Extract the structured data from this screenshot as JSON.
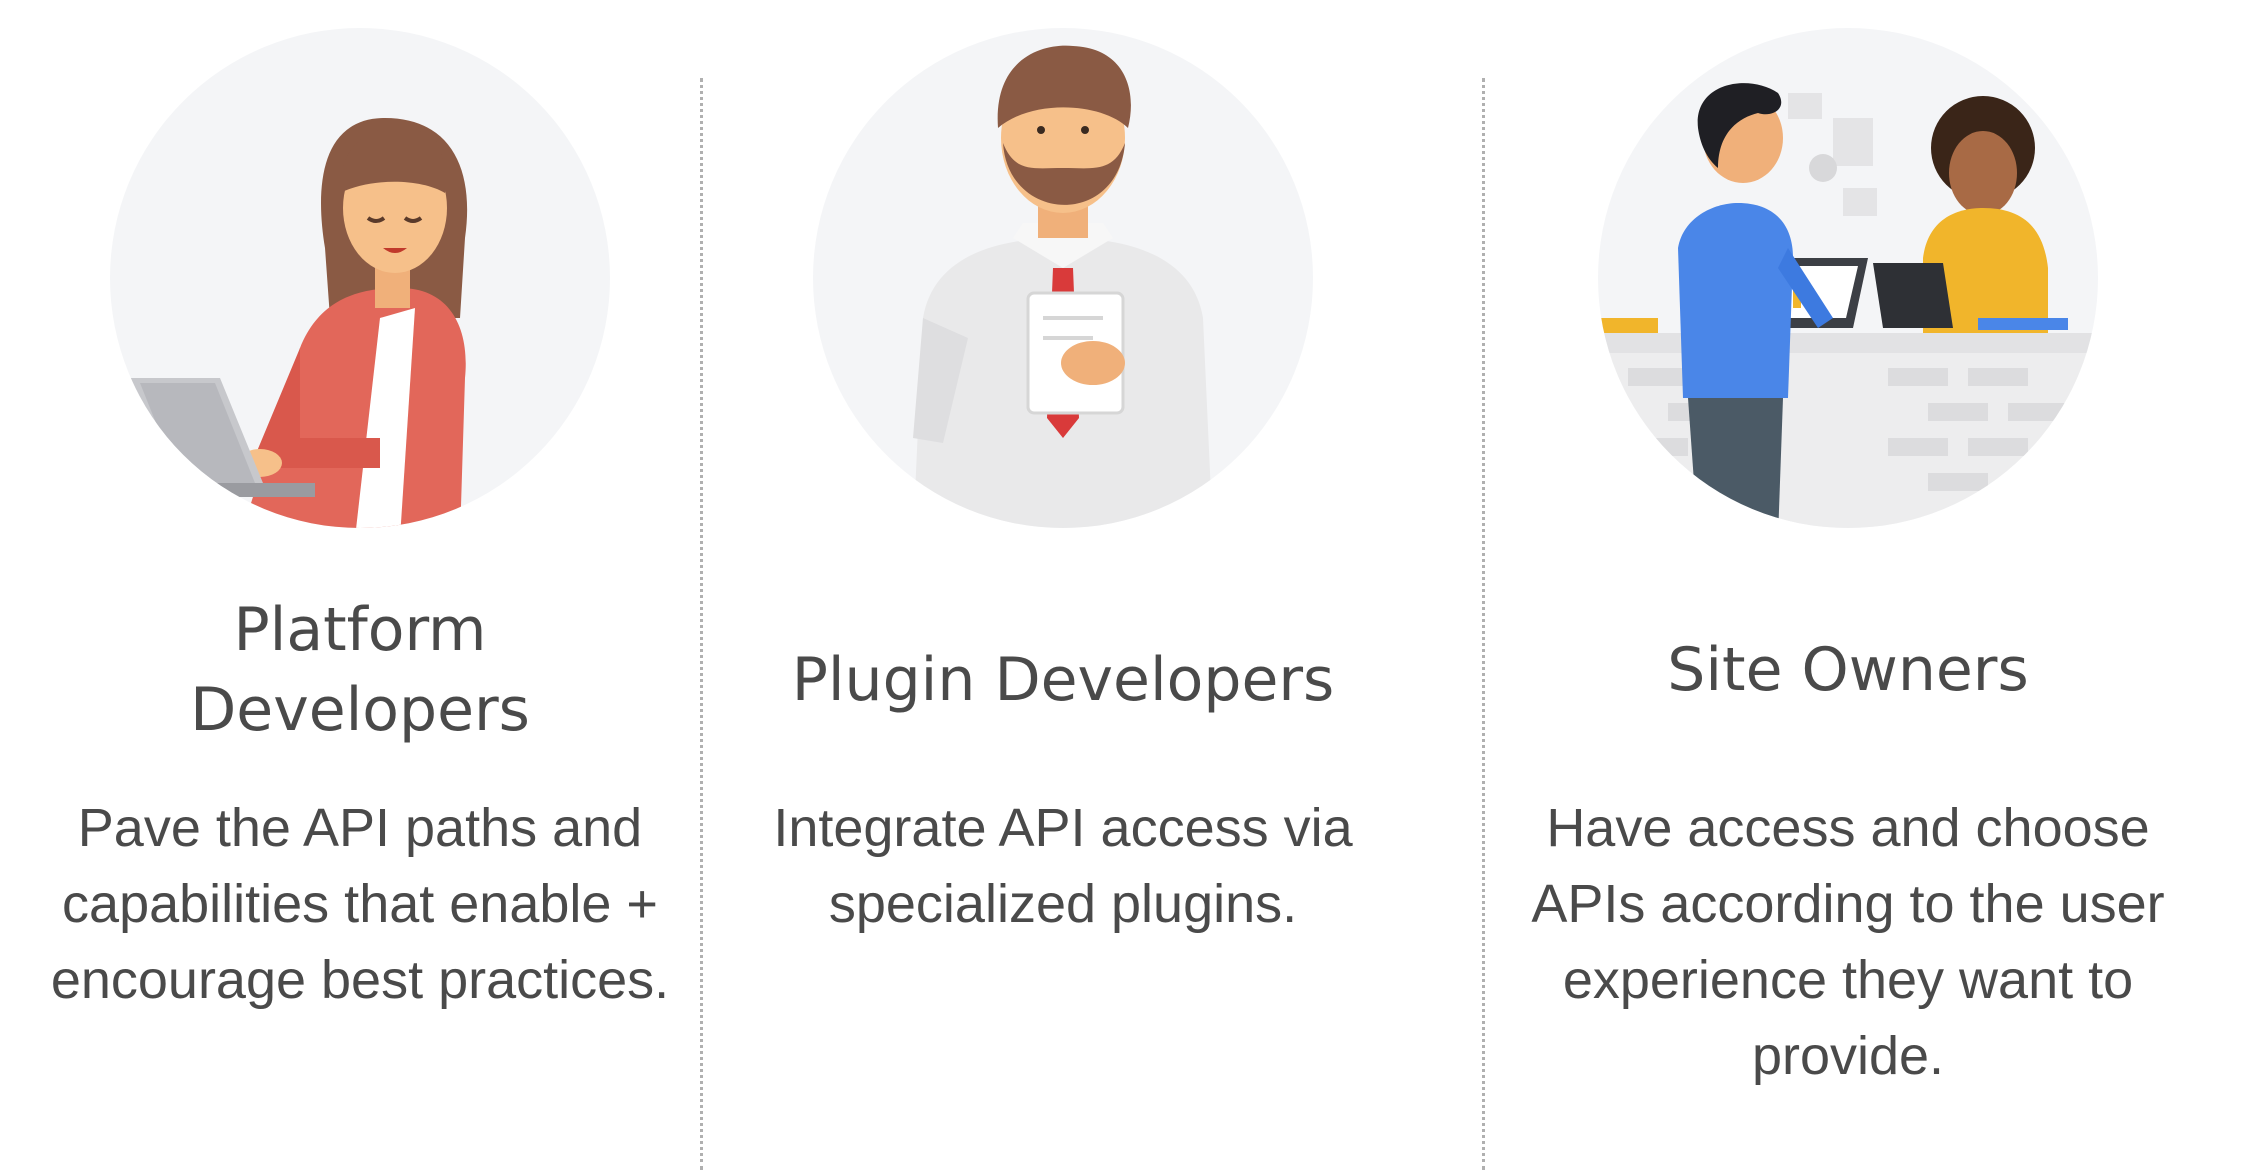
{
  "columns": [
    {
      "title": "Platform\nDevelopers",
      "description": "Pave the API paths and capabilities that enable + encourage best practices.",
      "illustration_icon": "woman-with-laptop-icon"
    },
    {
      "title": "Plugin Developers",
      "description": "Integrate API access via specialized plugins.",
      "illustration_icon": "bearded-man-with-document-icon"
    },
    {
      "title": "Site Owners",
      "description": "Have access and choose APIs according to the user experience they want to provide.",
      "illustration_icon": "people-at-counter-icon"
    }
  ],
  "colors": {
    "circle_bg": "#f4f5f7",
    "text": "#4a4a4a",
    "divider": "#b0b0b0"
  }
}
